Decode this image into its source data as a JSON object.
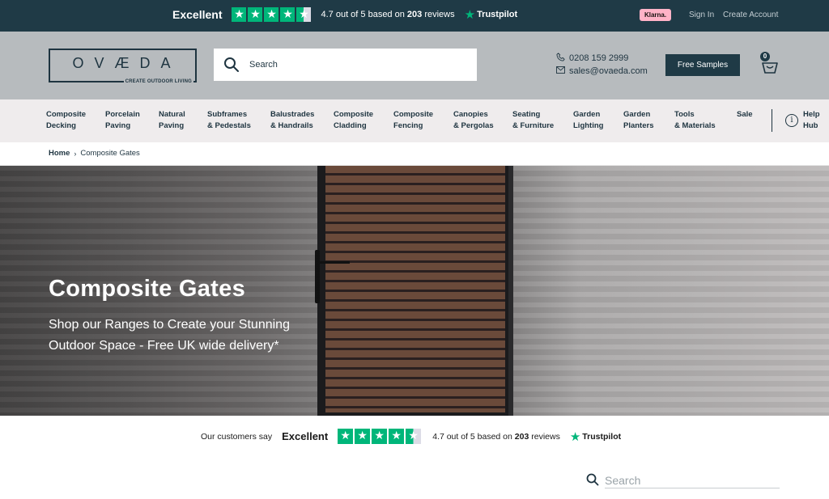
{
  "topbar": {
    "rating_word": "Excellent",
    "rating_text_prefix": "4.7 out of 5 based on ",
    "review_count": "203",
    "rating_text_suffix": " reviews",
    "trustpilot_label": "Trustpilot",
    "klarna_label": "Klarna.",
    "sign_in": "Sign In",
    "create_account": "Create Account",
    "star_color": "#00b67a",
    "stars": 4.5
  },
  "header": {
    "logo_text": "OVÆDA",
    "logo_tagline": "CREATE OUTDOOR LIVING",
    "search_placeholder": "Search",
    "phone": "0208 159 2999",
    "email": "sales@ovaeda.com",
    "free_samples": "Free Samples",
    "basket_count": "0"
  },
  "nav": {
    "items": [
      {
        "line1": "Composite",
        "line2": "Decking"
      },
      {
        "line1": "Porcelain",
        "line2": "Paving"
      },
      {
        "line1": "Natural",
        "line2": "Paving"
      },
      {
        "line1": "Subframes",
        "line2": "& Pedestals"
      },
      {
        "line1": "Balustrades",
        "line2": "& Handrails"
      },
      {
        "line1": "Composite",
        "line2": "Cladding"
      },
      {
        "line1": "Composite",
        "line2": "Fencing"
      },
      {
        "line1": "Canopies",
        "line2": "& Pergolas"
      },
      {
        "line1": "Seating",
        "line2": "& Furniture"
      },
      {
        "line1": "Garden",
        "line2": "Lighting"
      },
      {
        "line1": "Garden",
        "line2": "Planters"
      },
      {
        "line1": "Tools",
        "line2": "& Materials"
      },
      {
        "line1": "Sale",
        "line2": ""
      }
    ],
    "help": {
      "line1": "Help",
      "line2": "Hub"
    }
  },
  "breadcrumb": {
    "home": "Home",
    "separator": "›",
    "current": "Composite Gates"
  },
  "hero": {
    "title": "Composite Gates",
    "subtitle": "Shop our Ranges to Create your Stunning Outdoor Space - Free UK wide delivery*"
  },
  "trustband": {
    "intro": "Our customers say",
    "rating_word": "Excellent",
    "rating_text_prefix": "4.7 out of 5 based on ",
    "review_count": "203",
    "rating_text_suffix": " reviews",
    "trustpilot_label": "Trustpilot"
  },
  "bottom_search": {
    "placeholder": "Search"
  },
  "icons": {
    "star": "★",
    "phone": "phone-icon",
    "mail": "mail-icon",
    "search": "search-icon",
    "basket": "basket-icon",
    "info": "info-icon"
  }
}
